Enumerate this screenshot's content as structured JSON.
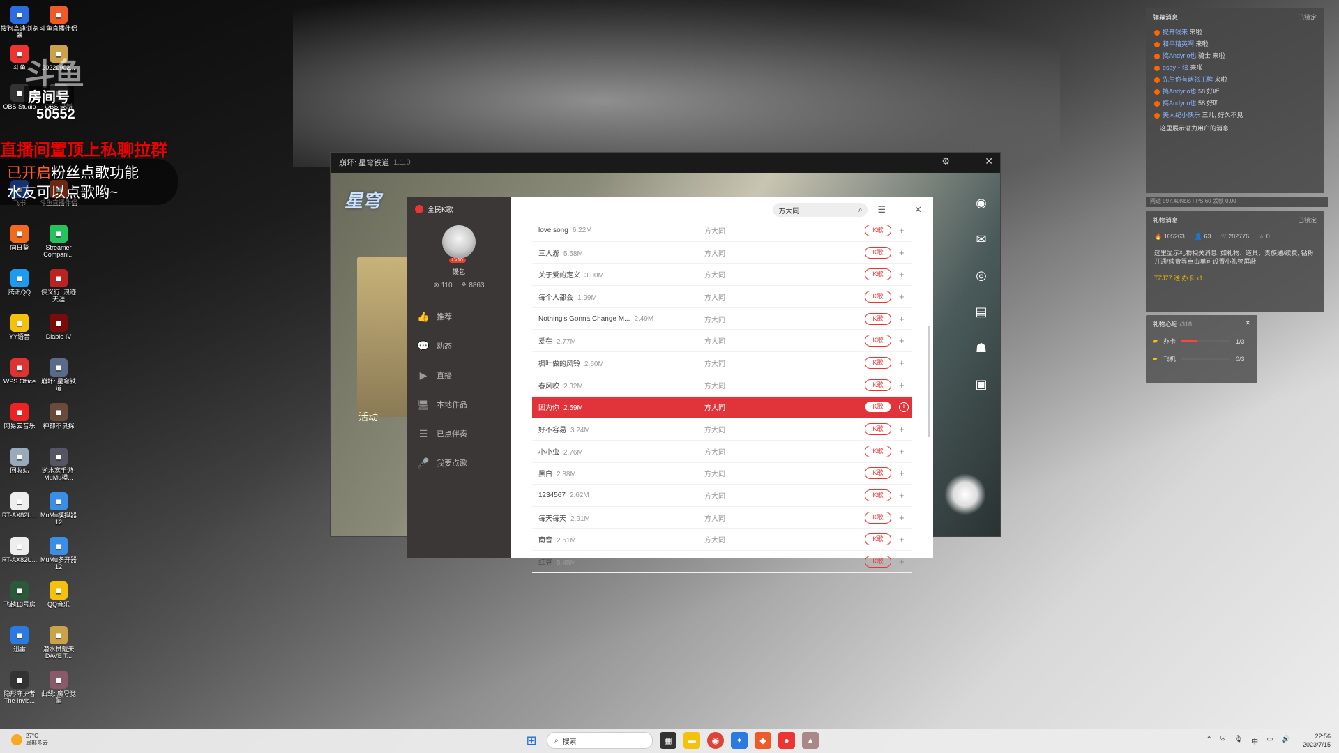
{
  "overlay": {
    "brand": "斗鱼",
    "room_label": "房间号",
    "room_number": "50552",
    "line1": "直播间置顶上私聊拉群",
    "line2_prefix": "已开启",
    "line2_rest": "粉丝点歌功能",
    "line3": "水友可以点歌哟~"
  },
  "desktop_icons": [
    {
      "label": "搜狗高速浏览器",
      "icon": "browser-icon",
      "color": "#2a6de0"
    },
    {
      "label": "斗鱼直播伴侣",
      "icon": "app-icon",
      "color": "#f05a28"
    },
    {
      "label": "斗鱼",
      "icon": "app-icon",
      "color": "#e33"
    },
    {
      "label": "20220902...",
      "icon": "folder-icon",
      "color": "#c9a24a"
    },
    {
      "label": "OBS Studio",
      "icon": "obs-icon",
      "color": "#333"
    },
    {
      "label": "OBS 录制",
      "icon": "obs-icon",
      "color": "#444"
    },
    {
      "label": "飞书",
      "icon": "feishu-icon",
      "color": "#3370ff"
    },
    {
      "label": "斗鱼直播伴侣",
      "icon": "app-icon",
      "color": "#f05a28"
    },
    {
      "label": "向日葵",
      "icon": "sunflower-icon",
      "color": "#f26b1d"
    },
    {
      "label": "Streamer Compani...",
      "icon": "streamer-icon",
      "color": "#25c25e"
    },
    {
      "label": "腾讯QQ",
      "icon": "qq-icon",
      "color": "#1d9bf0"
    },
    {
      "label": "侠义行: 浪迹天涯",
      "icon": "game-icon",
      "color": "#b22"
    },
    {
      "label": "YY语音",
      "icon": "yy-icon",
      "color": "#f4c20d"
    },
    {
      "label": "Diablo IV",
      "icon": "diablo-icon",
      "color": "#7a0b0b"
    },
    {
      "label": "WPS Office",
      "icon": "wps-icon",
      "color": "#d33"
    },
    {
      "label": "崩坏: 星穹铁道",
      "icon": "game-icon",
      "color": "#5a6a8a"
    },
    {
      "label": "网易云音乐",
      "icon": "music-icon",
      "color": "#e22"
    },
    {
      "label": "神都不良探",
      "icon": "game-icon",
      "color": "#6a4a3a"
    },
    {
      "label": "回收站",
      "icon": "recycle-bin-icon",
      "color": "#9ab"
    },
    {
      "label": "逆水寒手游-MuMu模...",
      "icon": "game-icon",
      "color": "#556"
    },
    {
      "label": "RT-AX82U...",
      "icon": "file-icon",
      "color": "#eee"
    },
    {
      "label": "MuMu模拟器12",
      "icon": "mumu-icon",
      "color": "#3a8ee6"
    },
    {
      "label": "RT-AX82U...",
      "icon": "file-icon",
      "color": "#eee"
    },
    {
      "label": "MuMu多开器12",
      "icon": "mumu-icon",
      "color": "#3a8ee6"
    },
    {
      "label": "飞越13号房",
      "icon": "game-icon",
      "color": "#2a5a3a"
    },
    {
      "label": "QQ音乐",
      "icon": "qqmusic-icon",
      "color": "#f4c20d"
    },
    {
      "label": "迅雷",
      "icon": "xunlei-icon",
      "color": "#2a7ae2"
    },
    {
      "label": "潜水员戴夫 DAVE T...",
      "icon": "game-icon",
      "color": "#c9a24a"
    },
    {
      "label": "隐形守护者 The Invis...",
      "icon": "game-icon",
      "color": "#333"
    },
    {
      "label": "曲线: 魔导觉醒",
      "icon": "game-icon",
      "color": "#8a5a6a"
    }
  ],
  "game_window": {
    "title": "崩坏: 星穹铁道",
    "version": "1.1.0",
    "logo": "星穹",
    "activity": "活动"
  },
  "ktv": {
    "app_name": "全民K歌",
    "level": "LV10",
    "username": "馒包",
    "stat1": "110",
    "stat2": "8863",
    "nav": [
      {
        "label": "推荐",
        "icon": "thumb-icon"
      },
      {
        "label": "动态",
        "icon": "chat-icon"
      },
      {
        "label": "直播",
        "icon": "live-icon"
      },
      {
        "label": "本地作品",
        "icon": "monitor-icon"
      },
      {
        "label": "已点伴奏",
        "icon": "list-icon"
      },
      {
        "label": "我要点歌",
        "icon": "mic-icon"
      }
    ],
    "search_value": "方大同",
    "k_label": "K歌",
    "songs": [
      {
        "name": "love song",
        "size": "6.22M",
        "artist": "方大同"
      },
      {
        "name": "三人游",
        "size": "5.58M",
        "artist": "方大同"
      },
      {
        "name": "关于爱的定义",
        "size": "3.00M",
        "artist": "方大同"
      },
      {
        "name": "每个人都会",
        "size": "1.99M",
        "artist": "方大同"
      },
      {
        "name": "Nothing's Gonna Change M...",
        "size": "2.49M",
        "artist": "方大同"
      },
      {
        "name": "爱在",
        "size": "2.77M",
        "artist": "方大同"
      },
      {
        "name": "枫叶做的风铃",
        "size": "2.60M",
        "artist": "方大同"
      },
      {
        "name": "春风吹",
        "size": "2.32M",
        "artist": "方大同"
      },
      {
        "name": "因为你",
        "size": "2.59M",
        "artist": "方大同",
        "active": true
      },
      {
        "name": "好不容易",
        "size": "3.24M",
        "artist": "方大同"
      },
      {
        "name": "小小虫",
        "size": "2.76M",
        "artist": "方大同"
      },
      {
        "name": "黑白",
        "size": "2.88M",
        "artist": "方大同"
      },
      {
        "name": "1234567",
        "size": "2.62M",
        "artist": "方大同"
      },
      {
        "name": "每天每天",
        "size": "2.91M",
        "artist": "方大同"
      },
      {
        "name": "南音",
        "size": "2.51M",
        "artist": "方大同"
      },
      {
        "name": "红豆",
        "size": "5.45M",
        "artist": "方大同"
      }
    ]
  },
  "danmu": {
    "title": "弹幕消息",
    "lock": "已锁定",
    "lines": [
      {
        "user": "提开钱来",
        "text": "来啦"
      },
      {
        "user": "和平精英啊",
        "text": "来啦"
      },
      {
        "user": "搞Andyrio也",
        "text": "骑士 来啦"
      },
      {
        "user": "esay・炫",
        "text": "来啦"
      },
      {
        "user": "先生你有两张王牌",
        "text": "来啦"
      },
      {
        "user": "搞Andyrio也",
        "text": "58 好听"
      },
      {
        "user": "搞Andyrio也",
        "text": "58 好听"
      },
      {
        "user": "美人纪小快乐",
        "text": "三儿, 好久不见"
      }
    ],
    "hint": "这里展示潜力用户的消息"
  },
  "stats_bar": "网速 997.40Kb/s  FPS 60  丢帧 0.00",
  "gift": {
    "title": "礼物消息",
    "lock": "已锁定",
    "stats": [
      "105263",
      "63",
      "282776",
      "0"
    ],
    "hint": "这里显示礼物相关消息, 如礼物、道具、贵族通/续费, 钻粉开通/续费等点击单可设置小礼物屏蔽",
    "recent": "TZJ77 送 办卡 x1"
  },
  "wish": {
    "title": "礼物心愿",
    "count": "/318",
    "items": [
      {
        "name": "办卡",
        "progress": "1/3",
        "fraction": 0.33
      },
      {
        "name": "飞机",
        "progress": "0/3",
        "fraction": 0
      }
    ]
  },
  "taskbar": {
    "temp": "27°C",
    "weather": "局部多云",
    "search_placeholder": "搜索",
    "time": "22:56",
    "date": "2023/7/15",
    "ime": "中"
  }
}
